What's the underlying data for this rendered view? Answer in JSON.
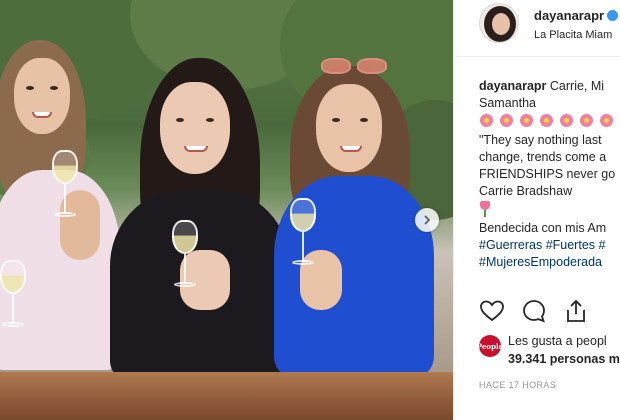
{
  "post": {
    "username": "dayanarapr",
    "location": "La Placita Miam",
    "caption_intro": "Carrie, Mi",
    "caption_intro_cont": "Samantha",
    "quote_line1": "\"They say nothing last",
    "quote_line2": "change, trends come a",
    "quote_line3": "FRIENDSHIPS never go",
    "quote_line4": "Carrie Bradshaw",
    "blessing": "Bendecida con mis Am",
    "hashtags_line1": "#Guerreras #Fuertes #",
    "hashtags_line2": "#MujeresEmpoderada",
    "likes_avatar_text": "People",
    "likes_text": "Les gusta a peopl",
    "likes_count": "39.341 personas m",
    "timestamp": "HACE 17 HORAS"
  },
  "icons": {
    "like": "heart-icon",
    "comment": "comment-icon",
    "share": "share-icon",
    "next": "chevron-right-icon",
    "verified": "verified-badge-icon"
  },
  "colors": {
    "hashtag": "#003569",
    "verified": "#3897f0",
    "timestamp": "#999999",
    "text": "#262626"
  }
}
